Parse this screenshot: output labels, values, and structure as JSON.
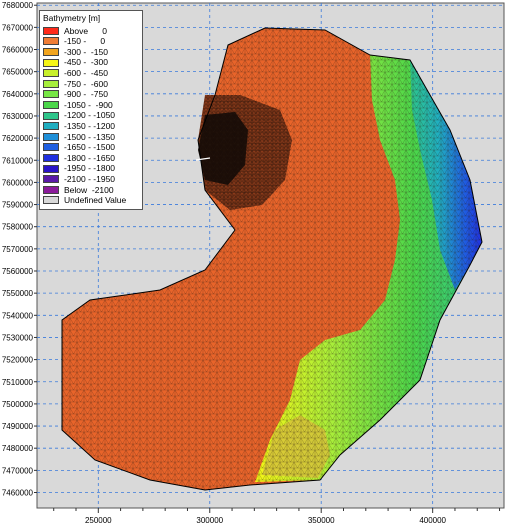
{
  "legend": {
    "title": "Bathymetry [m]",
    "items": [
      {
        "label": "Above      0",
        "color": "#ff2a1a"
      },
      {
        "label": "-150 -      0",
        "color": "#f07d35"
      },
      {
        "label": "-300 -  -150",
        "color": "#f2a51e"
      },
      {
        "label": "-450 -  -300",
        "color": "#f5f516"
      },
      {
        "label": "-600 -  -450",
        "color": "#c8f02a"
      },
      {
        "label": "-750 -  -600",
        "color": "#a6ee3b"
      },
      {
        "label": "-900 -  -750",
        "color": "#76e645"
      },
      {
        "label": "-1050 -  -900",
        "color": "#4bd64a"
      },
      {
        "label": "-1200 - -1050",
        "color": "#2ec58a"
      },
      {
        "label": "-1350 - -1200",
        "color": "#20aec0"
      },
      {
        "label": "-1500 - -1350",
        "color": "#1f8fd8"
      },
      {
        "label": "-1650 - -1500",
        "color": "#1f5fe0"
      },
      {
        "label": "-1800 - -1650",
        "color": "#2030e0"
      },
      {
        "label": "-1950 - -1800",
        "color": "#2a14c8"
      },
      {
        "label": "-2100 - -1950",
        "color": "#5a1aa8"
      },
      {
        "label": "Below  -2100",
        "color": "#8a1a9a"
      },
      {
        "label": "Undefined Value",
        "color": "#d8d8d8"
      }
    ]
  },
  "axes": {
    "x_ticks": [
      "250000",
      "300000",
      "350000",
      "400000"
    ],
    "x_values": [
      250000,
      300000,
      350000,
      400000
    ],
    "y_ticks": [
      "7680000",
      "7670000",
      "7660000",
      "7650000",
      "7640000",
      "7630000",
      "7620000",
      "7610000",
      "7600000",
      "7590000",
      "7580000",
      "7570000",
      "7560000",
      "7550000",
      "7540000",
      "7530000",
      "7520000",
      "7510000",
      "7500000",
      "7490000",
      "7480000",
      "7470000",
      "7460000"
    ],
    "y_values": [
      7680000,
      7670000,
      7660000,
      7650000,
      7640000,
      7630000,
      7620000,
      7610000,
      7600000,
      7590000,
      7580000,
      7570000,
      7560000,
      7550000,
      7540000,
      7530000,
      7520000,
      7510000,
      7500000,
      7490000,
      7480000,
      7470000,
      7460000
    ],
    "grid": true
  },
  "map": {
    "background_color": "#d9d9d9",
    "grid_color": "#3b7bdc"
  }
}
